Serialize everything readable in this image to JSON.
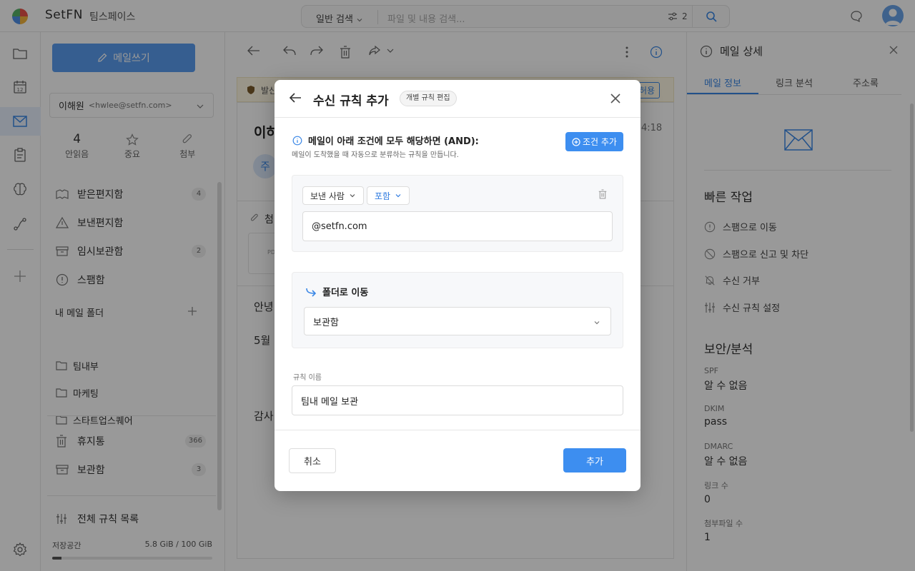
{
  "app": {
    "brand": "SetFN",
    "workspace": "팀스페이스"
  },
  "search": {
    "mode": "일반 검색",
    "placeholder": "파일 및 내용 검색...",
    "filter_count": "2"
  },
  "sidebar": {
    "compose_label": "메일쓰기",
    "account_name": "이해원",
    "account_email": "<hwlee@setfn.com>",
    "stats": [
      {
        "value": "4",
        "label": "안읽음"
      },
      {
        "label": "중요",
        "icon": "star-icon"
      },
      {
        "label": "첨부",
        "icon": "paperclip-icon"
      }
    ],
    "folders": [
      {
        "label": "받은편지함",
        "badge": "4",
        "icon": "inbox-icon"
      },
      {
        "label": "보낸편지함",
        "badge": "",
        "icon": "send-icon"
      },
      {
        "label": "임시보관함",
        "badge": "2",
        "icon": "draft-icon"
      },
      {
        "label": "스팸함",
        "badge": "",
        "icon": "spam-icon"
      }
    ],
    "my_folders_title": "내 메일 폴더",
    "my_folders": [
      {
        "label": "팀내부"
      },
      {
        "label": "마케팅"
      },
      {
        "label": "스타트업스퀘어"
      }
    ],
    "trash": {
      "label": "휴지통",
      "badge": "366"
    },
    "archive": {
      "label": "보관함",
      "badge": "3"
    },
    "rules": {
      "label": "전체 규칙 목록"
    },
    "storage": {
      "label": "저장공간",
      "value": "5.8 GiB / 100 GiB",
      "fraction": 0.058
    }
  },
  "main": {
    "notice_prefix": "발신",
    "notice_allow": "허용",
    "subject_prefix": "이하",
    "time_suffix": "4:18",
    "avatar_initial": "주",
    "attach_prefix": "첨",
    "attach_type": "PD",
    "body_1": "안녕",
    "body_2": "5월",
    "body_3": "감사"
  },
  "right_panel": {
    "title": "메일 상세",
    "tabs": [
      "메일 정보",
      "링크 분석",
      "주소록"
    ],
    "quick_title": "빠른 작업",
    "quick_actions": [
      "스팸으로 이동",
      "스팸으로 신고 및 차단",
      "수신 거부",
      "수신 규칙 설정"
    ],
    "security_title": "보안/분석",
    "fields": [
      {
        "k": "SPF",
        "v": "알 수 없음"
      },
      {
        "k": "DKIM",
        "v": "pass"
      },
      {
        "k": "DMARC",
        "v": "알 수 없음"
      },
      {
        "k": "링크 수",
        "v": "0"
      },
      {
        "k": "첨부파일 수",
        "v": "1"
      }
    ]
  },
  "modal": {
    "title": "수신 규칙 추가",
    "tag": "개별 규칙 편집",
    "condition_heading": "메일이 아래 조건에 모두 해당하면 (AND):",
    "condition_sub": "메일이 도착했을 때 자동으로 분류하는 규칙을 만듭니다.",
    "add_condition": "조건 추가",
    "field_select": "보낸 사람",
    "op_select": "포함",
    "value": "@setfn.com",
    "action_label": "폴더로 이동",
    "folder": "보관함",
    "rule_name_label": "규칙 이름",
    "rule_name": "팀내 메일 보관",
    "cancel": "취소",
    "submit": "추가"
  },
  "colors": {
    "accent": "#3d8ef0",
    "compose": "#5b9df0",
    "tab_active": "#3a87e6"
  }
}
